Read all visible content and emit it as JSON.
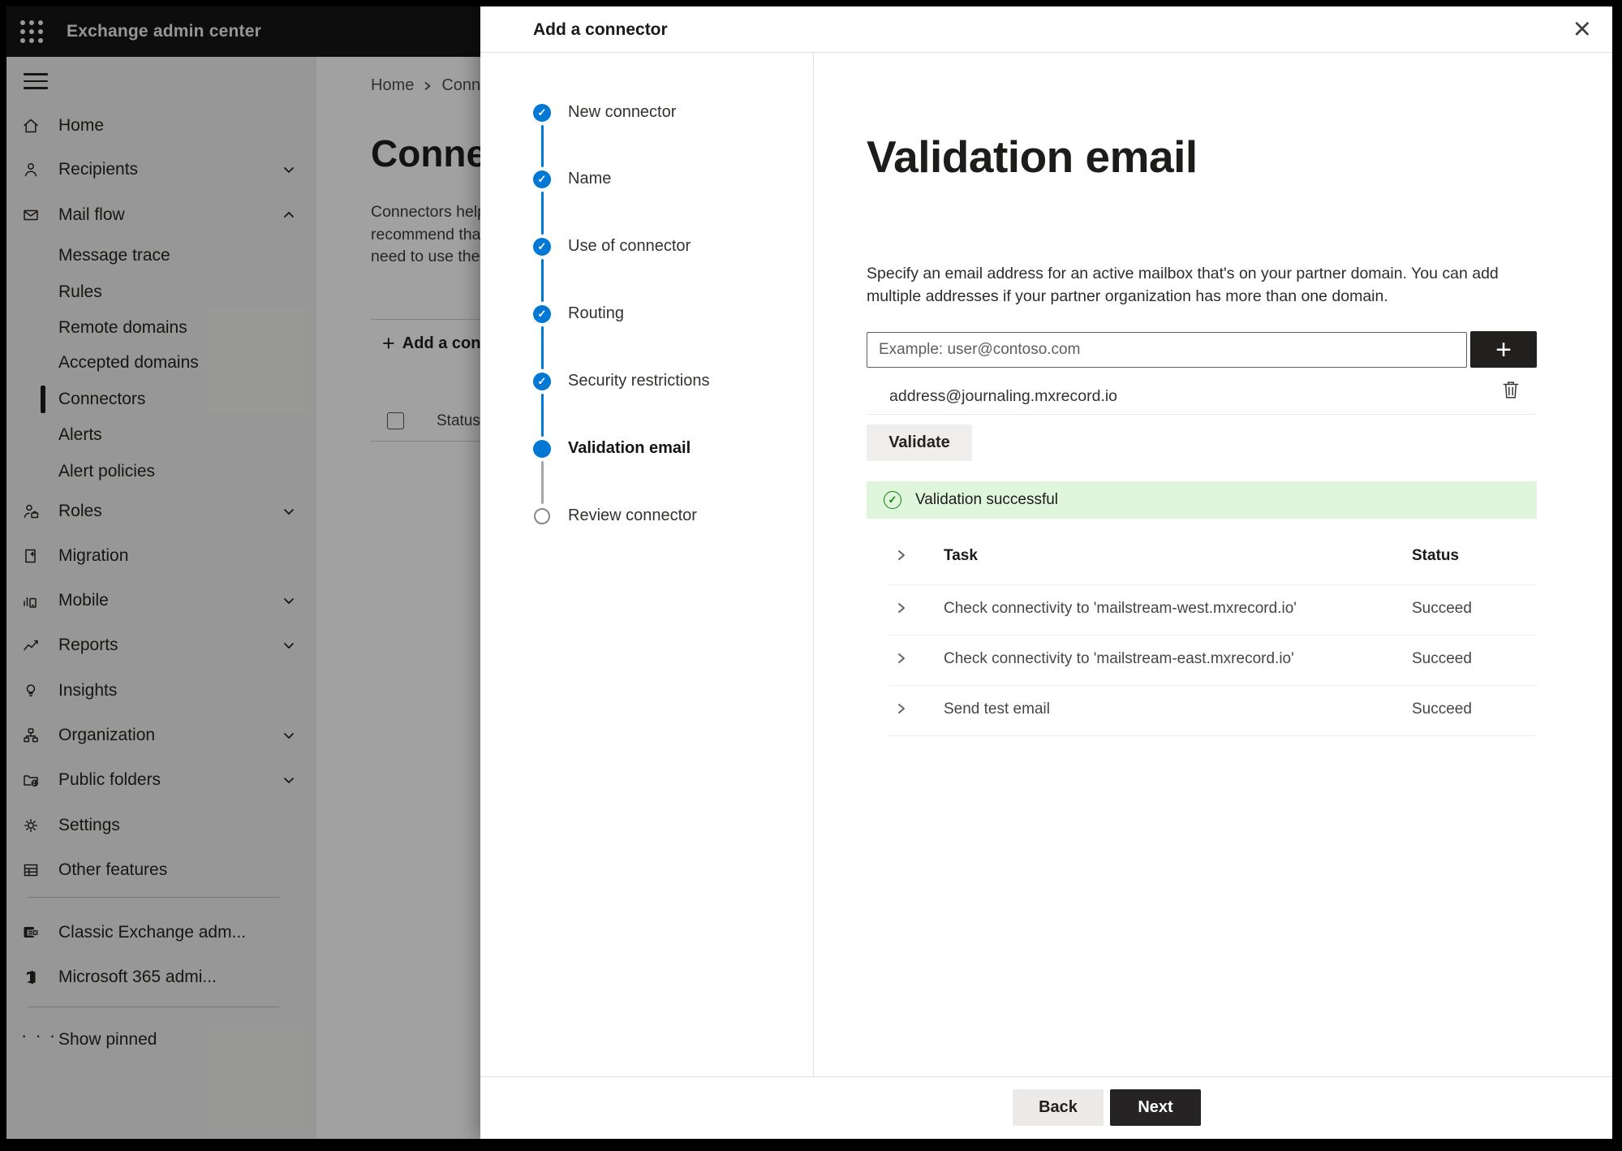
{
  "topbar": {
    "title": "Exchange admin center"
  },
  "sidebar": {
    "items": [
      {
        "label": "Home"
      },
      {
        "label": "Recipients"
      },
      {
        "label": "Mail flow"
      },
      {
        "label": "Message trace"
      },
      {
        "label": "Rules"
      },
      {
        "label": "Remote domains"
      },
      {
        "label": "Accepted domains"
      },
      {
        "label": "Connectors",
        "selected": true
      },
      {
        "label": "Alerts"
      },
      {
        "label": "Alert policies"
      },
      {
        "label": "Roles"
      },
      {
        "label": "Migration"
      },
      {
        "label": "Mobile"
      },
      {
        "label": "Reports"
      },
      {
        "label": "Insights"
      },
      {
        "label": "Organization"
      },
      {
        "label": "Public folders"
      },
      {
        "label": "Settings"
      },
      {
        "label": "Other features"
      },
      {
        "label": "Classic Exchange adm..."
      },
      {
        "label": "Microsoft 365 admi..."
      },
      {
        "label": "Show pinned"
      }
    ]
  },
  "background": {
    "breadcrumb": {
      "home": "Home",
      "current": "Conne"
    },
    "heading": "Connect",
    "paragraph_lines": [
      "Connectors help",
      "recommend that",
      "need to use ther"
    ],
    "add_button": "Add a conn",
    "status_header": "Status"
  },
  "wizard": {
    "title": "Add a connector",
    "steps": [
      {
        "label": "New connector",
        "state": "done"
      },
      {
        "label": "Name",
        "state": "done"
      },
      {
        "label": "Use of connector",
        "state": "done"
      },
      {
        "label": "Routing",
        "state": "done"
      },
      {
        "label": "Security restrictions",
        "state": "done"
      },
      {
        "label": "Validation email",
        "state": "current"
      },
      {
        "label": "Review connector",
        "state": "upcoming"
      }
    ],
    "page": {
      "heading": "Validation email",
      "description_lines": [
        "Specify an email address for an active mailbox that's on your partner domain. You can add",
        "multiple addresses if your partner organization has more than one domain."
      ],
      "email_input": {
        "value": "",
        "placeholder": "Example: user@contoso.com"
      },
      "added_address": "address@journaling.mxrecord.io",
      "validate_button": "Validate",
      "banner_text": "Validation successful",
      "results_table": {
        "columns": [
          "Task",
          "Status"
        ],
        "rows": [
          {
            "task": "Check connectivity to 'mailstream-west.mxrecord.io'",
            "status": "Succeed"
          },
          {
            "task": "Check connectivity to 'mailstream-east.mxrecord.io'",
            "status": "Succeed"
          },
          {
            "task": "Send test email",
            "status": "Succeed"
          }
        ]
      }
    },
    "footer": {
      "back": "Back",
      "next": "Next"
    }
  },
  "icons": {
    "check": "✓",
    "plus": "+",
    "close": "×",
    "ellipsis": "· · ·",
    "letter_e": "E"
  },
  "colors": {
    "accent": "#0078d4",
    "success_bg": "#dff6dd",
    "success_green": "#107c10",
    "primary_button": "#252323"
  }
}
